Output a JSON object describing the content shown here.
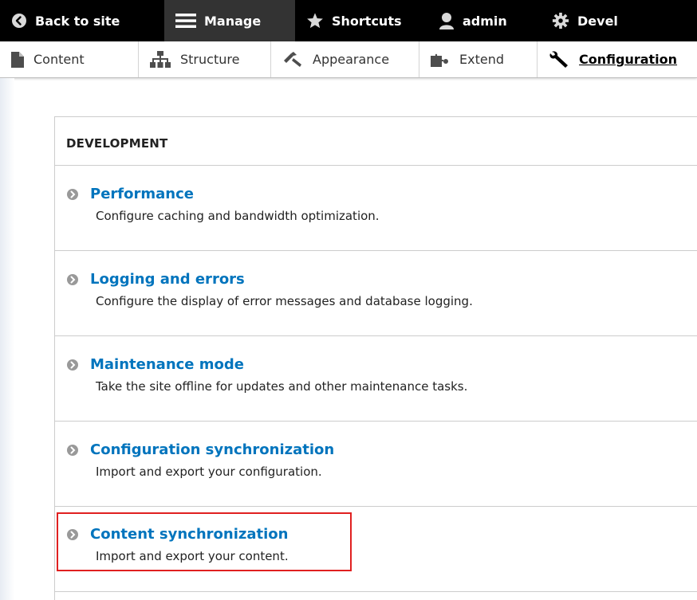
{
  "toolbar": {
    "back_label": "Back to site",
    "manage_label": "Manage",
    "shortcuts_label": "Shortcuts",
    "user_label": "admin",
    "devel_label": "Devel"
  },
  "tray": {
    "items": [
      {
        "label": "Content",
        "icon": "file-icon"
      },
      {
        "label": "Structure",
        "icon": "sitemap-icon"
      },
      {
        "label": "Appearance",
        "icon": "paintbrush-icon"
      },
      {
        "label": "Extend",
        "icon": "puzzle-icon"
      },
      {
        "label": "Configuration",
        "icon": "wrench-icon",
        "active": true
      }
    ]
  },
  "panel": {
    "title": "DEVELOPMENT",
    "items": [
      {
        "title": "Performance",
        "description": "Configure caching and bandwidth optimization."
      },
      {
        "title": "Logging and errors",
        "description": "Configure the display of error messages and database logging."
      },
      {
        "title": "Maintenance mode",
        "description": "Take the site offline for updates and other maintenance tasks."
      },
      {
        "title": "Configuration synchronization",
        "description": "Import and export your configuration."
      },
      {
        "title": "Content synchronization",
        "description": "Import and export your content."
      }
    ]
  },
  "colors": {
    "link": "#0074bd",
    "toolbar_bg": "#000000",
    "highlight": "#e02020"
  }
}
